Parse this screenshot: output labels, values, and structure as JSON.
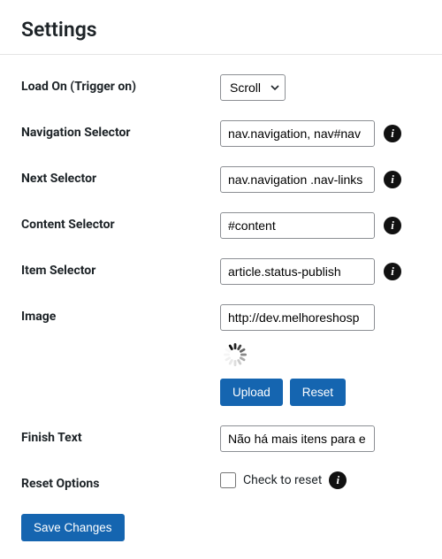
{
  "title": "Settings",
  "labels": {
    "load_on": "Load On (Trigger on)",
    "nav_selector": "Navigation Selector",
    "next_selector": "Next Selector",
    "content_selector": "Content Selector",
    "item_selector": "Item Selector",
    "image": "Image",
    "finish_text": "Finish Text",
    "reset_options": "Reset Options"
  },
  "fields": {
    "load_on": "Scroll",
    "nav_selector": "nav.navigation, nav#nav",
    "next_selector": "nav.navigation .nav-links",
    "content_selector": "#content",
    "item_selector": "article.status-publish",
    "image": "http://dev.melhoreshosp",
    "finish_text": "Não há mais itens para e"
  },
  "buttons": {
    "upload": "Upload",
    "reset": "Reset",
    "save": "Save Changes"
  },
  "checkbox": {
    "reset_label": "Check to reset"
  }
}
